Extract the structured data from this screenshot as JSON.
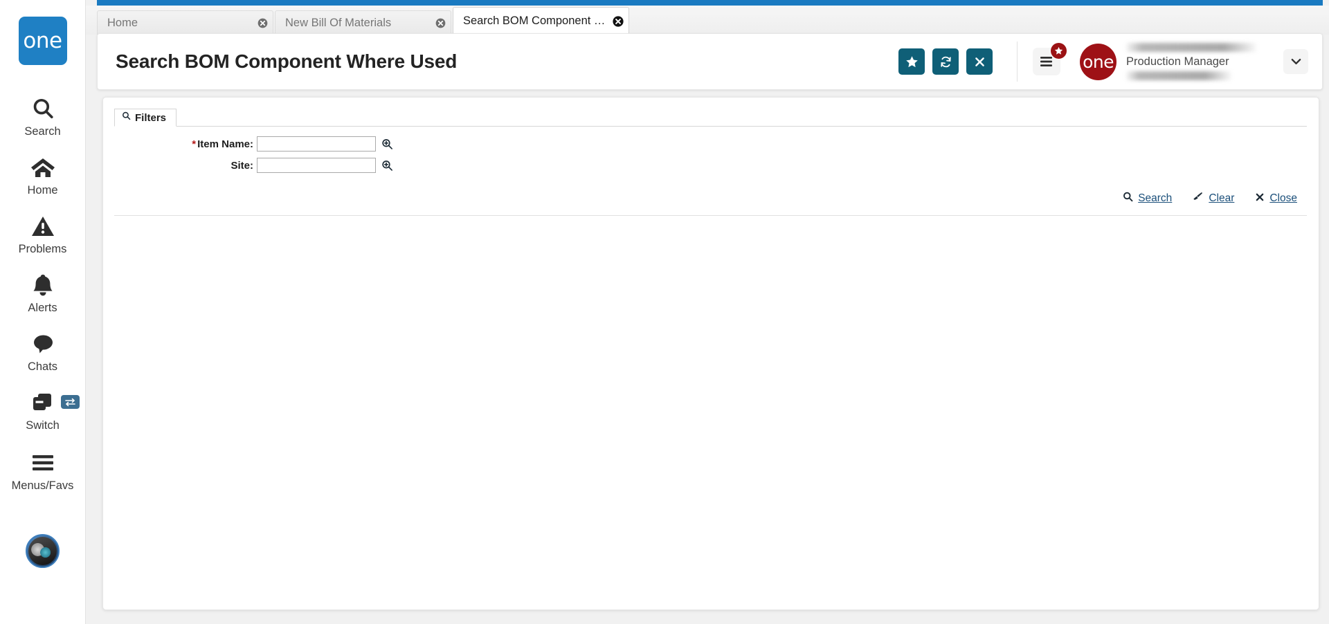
{
  "sidebar": {
    "brand": {
      "logo_text": "one",
      "color": "#1f80c4"
    },
    "items": [
      {
        "id": "search",
        "label": "Search",
        "icon": "magnifier-icon"
      },
      {
        "id": "home",
        "label": "Home",
        "icon": "house-icon"
      },
      {
        "id": "problems",
        "label": "Problems",
        "icon": "warning-triangle-icon"
      },
      {
        "id": "alerts",
        "label": "Alerts",
        "icon": "bell-icon"
      },
      {
        "id": "chats",
        "label": "Chats",
        "icon": "speech-bubble-icon"
      },
      {
        "id": "switch",
        "label": "Switch",
        "icon": "copy-windows-icon",
        "badge_icon": "arrows-swap-icon"
      },
      {
        "id": "menus",
        "label": "Menus/Favs",
        "icon": "hamburger-icon"
      }
    ],
    "avatar": {
      "name": "user-avatar"
    }
  },
  "tabs": [
    {
      "label": "Home",
      "active": false,
      "close_icon": "close-circle-icon"
    },
    {
      "label": "New Bill Of Materials",
      "active": false,
      "close_icon": "close-circle-icon"
    },
    {
      "label": "Search BOM Component Where ...",
      "active": true,
      "close_icon": "close-circle-icon"
    }
  ],
  "header": {
    "title": "Search BOM Component Where Used",
    "actions": [
      {
        "id": "favorite",
        "icon": "star-icon",
        "title": "Favorite"
      },
      {
        "id": "refresh",
        "icon": "refresh-icon",
        "title": "Refresh"
      },
      {
        "id": "close",
        "icon": "x-icon",
        "title": "Close"
      }
    ],
    "accent_color": "#0f5f77",
    "menu_favorites": {
      "icon": "hamburger-icon",
      "badge_icon": "star-icon",
      "badge_color": "#9b1214"
    },
    "org_logo": {
      "logo_text": "one",
      "color": "#9e1116"
    },
    "user": {
      "name_redacted": "",
      "role": "Production Manager",
      "extra_redacted": ""
    },
    "caret_icon": "chevron-down-icon"
  },
  "filters": {
    "tab_label": "Filters",
    "tab_icon": "magnifier-icon",
    "fields": [
      {
        "id": "item-name",
        "label": "Item Name:",
        "required": true,
        "value": "",
        "placeholder": "",
        "lookup_icon": "magnifier-plus-icon"
      },
      {
        "id": "site",
        "label": "Site:",
        "required": false,
        "value": "",
        "placeholder": "",
        "lookup_icon": "magnifier-plus-icon"
      }
    ],
    "actions": [
      {
        "id": "search",
        "label": "Search",
        "icon": "magnifier-icon"
      },
      {
        "id": "clear",
        "label": "Clear",
        "icon": "eraser-icon"
      },
      {
        "id": "close",
        "label": "Close",
        "icon": "x-icon"
      }
    ]
  }
}
